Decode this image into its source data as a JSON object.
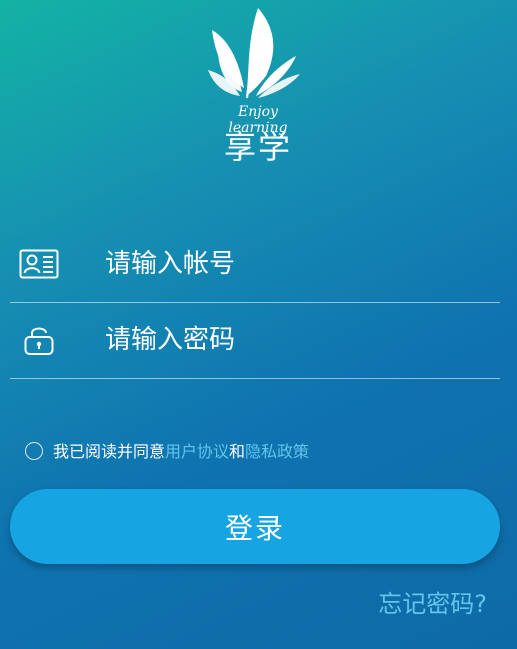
{
  "logo": {
    "icon": "leaf-wings-icon",
    "tagline": "Enjoy learning",
    "brand": "享学"
  },
  "login_form": {
    "account_placeholder": "请输入帐号",
    "account_icon": "id-card-icon",
    "password_placeholder": "请输入密码",
    "password_icon": "unlock-icon"
  },
  "agreement": {
    "prefix": "我已阅读并同意",
    "user_agreement_link": "用户协议",
    "conjunction": "和",
    "privacy_policy_link": "隐私政策",
    "checked": false
  },
  "actions": {
    "login_label": "登录",
    "forgot_password_label": "忘记密码?"
  },
  "colors": {
    "accent": "#17a4e2",
    "link": "#63c4ec",
    "background_start": "#13b3a4",
    "background_end": "#0e6aa6"
  }
}
